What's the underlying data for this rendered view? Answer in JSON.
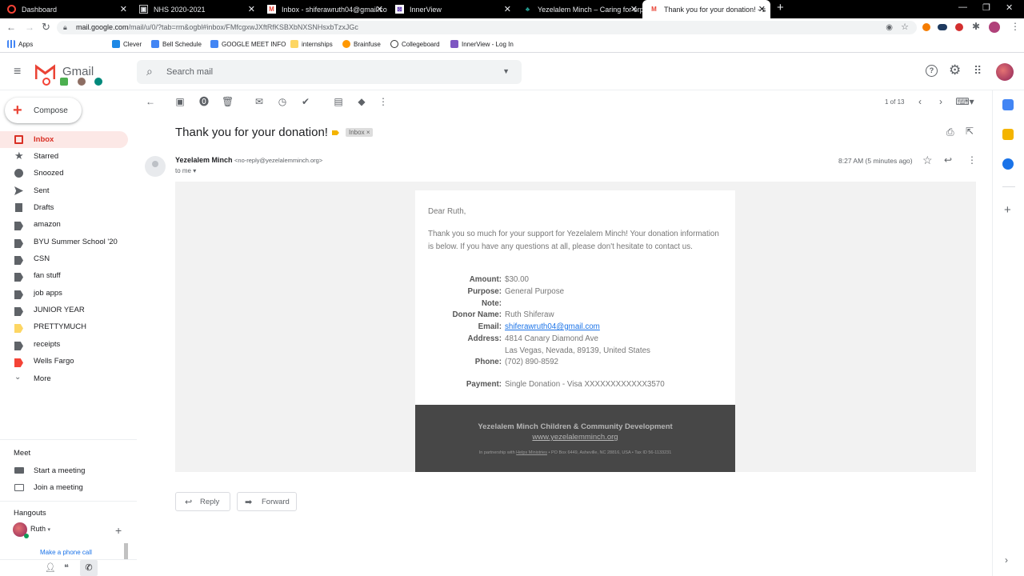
{
  "browser": {
    "tabs": [
      {
        "title": "Dashboard",
        "icon": "ring-logo-icon",
        "color": "#f44336"
      },
      {
        "title": "NHS 2020-2021",
        "icon": "image-icon",
        "color": "#9e9e9e"
      },
      {
        "title": "Inbox - shiferawruth04@gmail.co",
        "icon": "gmail-icon",
        "color": "#ea4335"
      },
      {
        "title": "InnerView",
        "icon": "innerview-icon",
        "color": "#ffffff"
      },
      {
        "title": "Yezelalem Minch – Caring for orp",
        "icon": "tree-icon",
        "color": "#26a69a"
      },
      {
        "title": "Thank you for your donation! - s",
        "icon": "gmail-icon",
        "color": "#ea4335"
      }
    ],
    "url_host": "mail.google.com",
    "url_path": "/mail/u/0/?tab=rm&ogbl#inbox/FMfcgxwJXftRfKSBXbNXSNHsxbTzxJGc",
    "bookmarks": [
      "Apps",
      "Clever",
      "Bell Schedule",
      "GOOGLE MEET INFO",
      "internships",
      "Brainfuse",
      "Collegeboard",
      "InnerView - Log In"
    ]
  },
  "gmail": {
    "brand": "Gmail",
    "search_placeholder": "Search mail",
    "compose": "Compose",
    "nav": [
      {
        "label": "Inbox",
        "icon": "inbox-icon",
        "selected": true
      },
      {
        "label": "Starred",
        "icon": "star-icon"
      },
      {
        "label": "Snoozed",
        "icon": "clock-icon"
      },
      {
        "label": "Sent",
        "icon": "send-icon"
      },
      {
        "label": "Drafts",
        "icon": "draft-icon"
      },
      {
        "label": "amazon",
        "icon": "label-icon",
        "color": "#5f6368"
      },
      {
        "label": "BYU Summer School '20",
        "icon": "label-icon",
        "color": "#5f6368"
      },
      {
        "label": "CSN",
        "icon": "label-icon",
        "color": "#5f6368"
      },
      {
        "label": "fan stuff",
        "icon": "label-icon",
        "color": "#5f6368"
      },
      {
        "label": "job apps",
        "icon": "label-icon",
        "color": "#5f6368"
      },
      {
        "label": "JUNIOR YEAR",
        "icon": "label-icon",
        "color": "#5f6368"
      },
      {
        "label": "PRETTYMUCH",
        "icon": "label-icon",
        "color": "#fdd663"
      },
      {
        "label": "receipts",
        "icon": "label-icon",
        "color": "#5f6368"
      },
      {
        "label": "Wells Fargo",
        "icon": "label-icon",
        "color": "#f44336"
      },
      {
        "label": "More",
        "icon": "chevron-down-icon"
      }
    ],
    "meet": {
      "title": "Meet",
      "start": "Start a meeting",
      "join": "Join a meeting"
    },
    "hangouts": {
      "title": "Hangouts",
      "user": "Ruth",
      "phone": "Make a phone call"
    },
    "pager": "1 of 13"
  },
  "message": {
    "subject": "Thank you for your donation!",
    "chip": "Inbox",
    "sender_name": "Yezelalem Minch",
    "sender_email": "<no-reply@yezelalemminch.org>",
    "to": "to me",
    "time": "8:27 AM (5 minutes ago)",
    "greeting": "Dear Ruth,",
    "body": "Thank you so much for your support for Yezelalem Minch!  Your donation information is below.  If you have any questions at all, please don't hesitate to contact us.",
    "fields": {
      "amount_k": "Amount:",
      "amount_v": "$30.00",
      "purpose_k": "Purpose:",
      "purpose_v": "General Purpose",
      "note_k": "Note:",
      "donor_k": "Donor Name:",
      "donor_v": "Ruth Shiferaw",
      "email_k": "Email:",
      "email_v": "shiferawruth04@gmail.com",
      "address_k": "Address:",
      "address_v1": "4814 Canary Diamond Ave",
      "address_v2": "Las Vegas, Nevada, 89139, United States",
      "phone_k": "Phone:",
      "phone_v": "(702) 890-8592",
      "payment_k": "Payment:",
      "payment_v": "Single Donation - Visa XXXXXXXXXXXX3570"
    },
    "footer_org": "Yezelalem Minch Children & Community Development",
    "footer_url": "www.yezelalemminch.org",
    "footer_small_pre": "In partnership with ",
    "footer_small_link": "Helps Ministries",
    "footer_small_post": " • PO Box 6449, Asheville, NC 28816, USA • Tax ID 56-1133231",
    "reply": "Reply",
    "forward": "Forward"
  }
}
